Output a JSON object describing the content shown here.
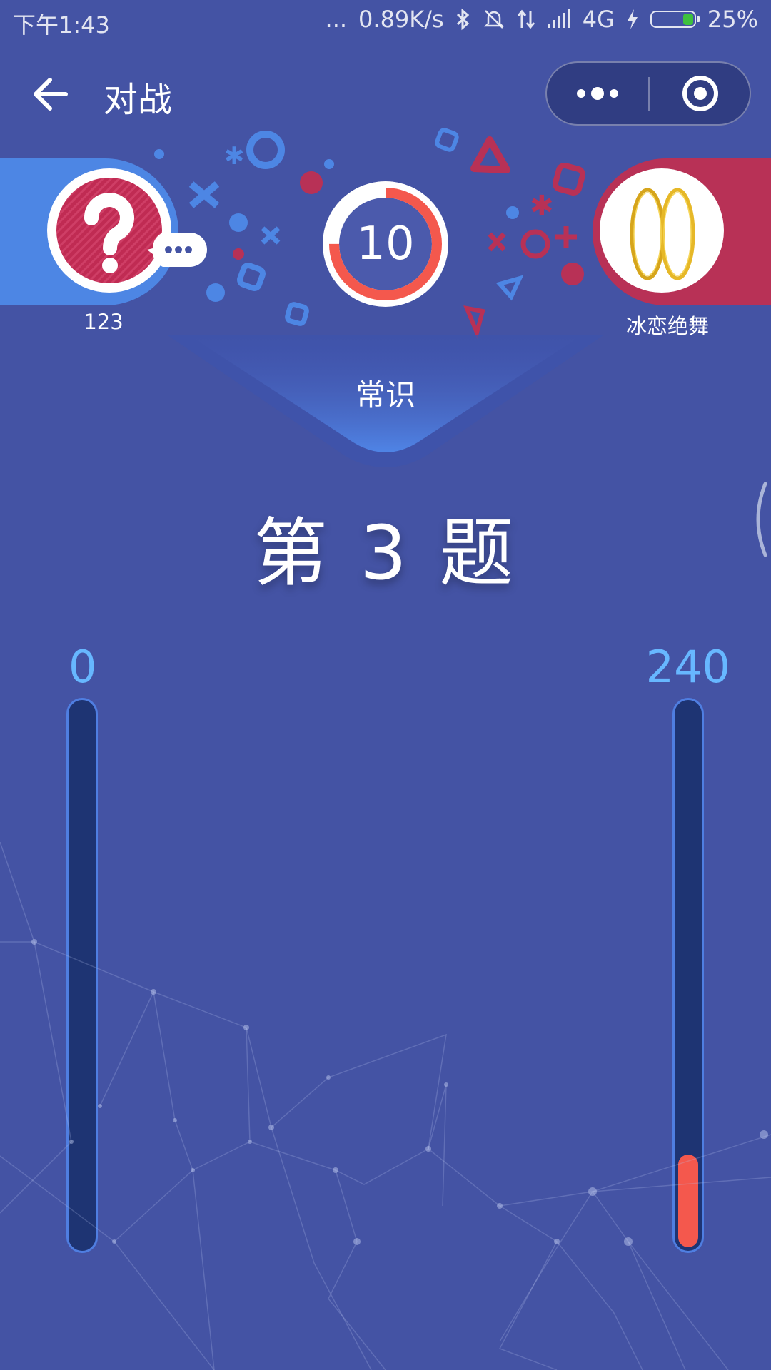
{
  "status_bar": {
    "time": "下午1:43",
    "dots": "...",
    "network_speed": "0.89K/s",
    "network_type": "4G",
    "battery": "25%",
    "icons": [
      "bluetooth-icon",
      "mute-icon",
      "data-arrows-icon",
      "signal-icon",
      "charging-icon",
      "battery-icon"
    ]
  },
  "nav": {
    "title": "对战",
    "back_icon": "back-arrow-icon",
    "more_icon": "more-dots-icon",
    "close_icon": "target-close-icon"
  },
  "player_left": {
    "name": "123",
    "score": "0",
    "score_fraction": 0,
    "avatar_icon": "question-mark-icon",
    "status_icon": "typing-bubble-icon"
  },
  "player_right": {
    "name": "冰恋绝舞",
    "score": "240",
    "score_fraction": 0.17,
    "avatar_icon": "earrings-icon"
  },
  "timer": {
    "seconds": "10",
    "progress_fraction": 0.75
  },
  "category": "常识",
  "question": {
    "title": "第 3 题"
  },
  "colors": {
    "background": "#4453a4",
    "left_accent": "#4d86e4",
    "right_accent": "#b83156",
    "timer_ring": "#f4584d",
    "score_text": "#67b7ff",
    "bar_fill": "#f4584d",
    "bar_track": "#1e3473"
  }
}
